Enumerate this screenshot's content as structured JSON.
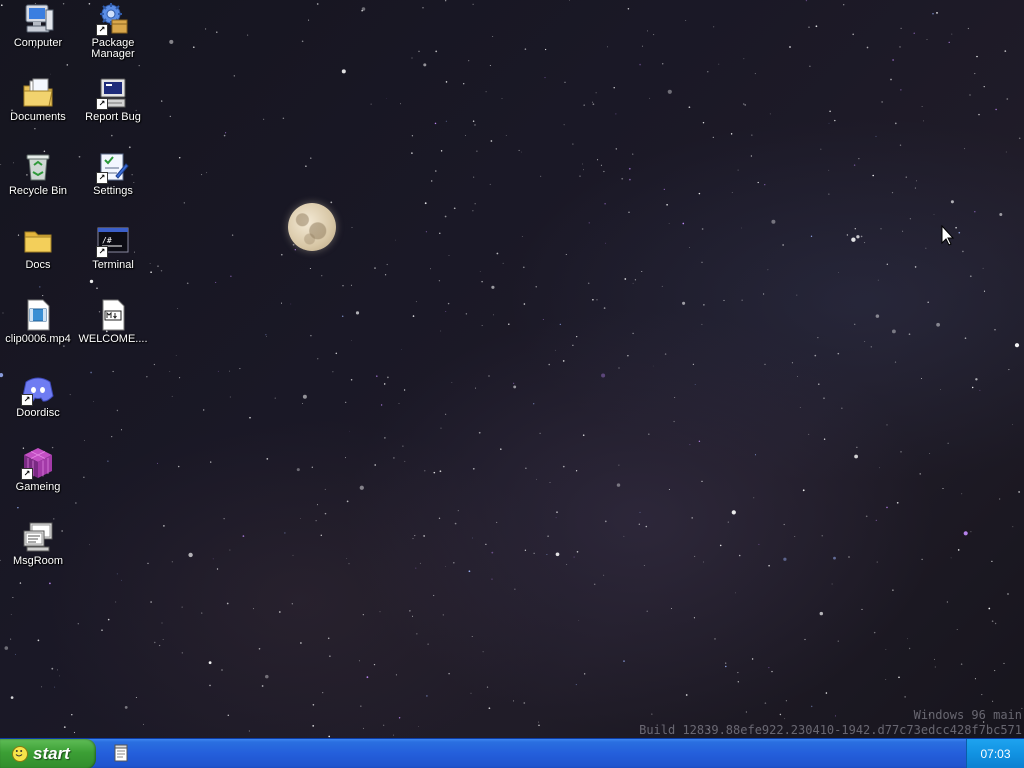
{
  "desktop": {
    "icons": [
      {
        "label": "Computer",
        "icon": "computer-icon",
        "shortcut": false
      },
      {
        "label": "Package Manager",
        "icon": "package-manager-icon",
        "shortcut": true
      },
      {
        "label": "Documents",
        "icon": "documents-folder-icon",
        "shortcut": false
      },
      {
        "label": "Report Bug",
        "icon": "report-bug-icon",
        "shortcut": true
      },
      {
        "label": "Recycle Bin",
        "icon": "recycle-bin-icon",
        "shortcut": false
      },
      {
        "label": "Settings",
        "icon": "settings-icon",
        "shortcut": true
      },
      {
        "label": "Docs",
        "icon": "folder-icon",
        "shortcut": false
      },
      {
        "label": "Terminal",
        "icon": "terminal-icon",
        "shortcut": true
      },
      {
        "label": "clip0006.mp4",
        "icon": "video-file-icon",
        "shortcut": false
      },
      {
        "label": "WELCOME....",
        "icon": "markdown-file-icon",
        "shortcut": false
      },
      {
        "label": "Doordisc",
        "icon": "discord-icon",
        "shortcut": true
      },
      {
        "label": "Gameing",
        "icon": "game-cube-icon",
        "shortcut": true
      },
      {
        "label": "MsgRoom",
        "icon": "msgroom-icon",
        "shortcut": false
      }
    ],
    "terminal_glyph": "/#"
  },
  "watermark": {
    "line1": "Windows 96 main",
    "line2": "Build 12839.88efe922.230410-1942.d77c73edcc428f7bc571"
  },
  "taskbar": {
    "start_label": "start",
    "clock": "07:03"
  },
  "colors": {
    "taskbar_blue": "#245edb",
    "start_green": "#3c9f35",
    "tray_blue": "#1192e2"
  }
}
